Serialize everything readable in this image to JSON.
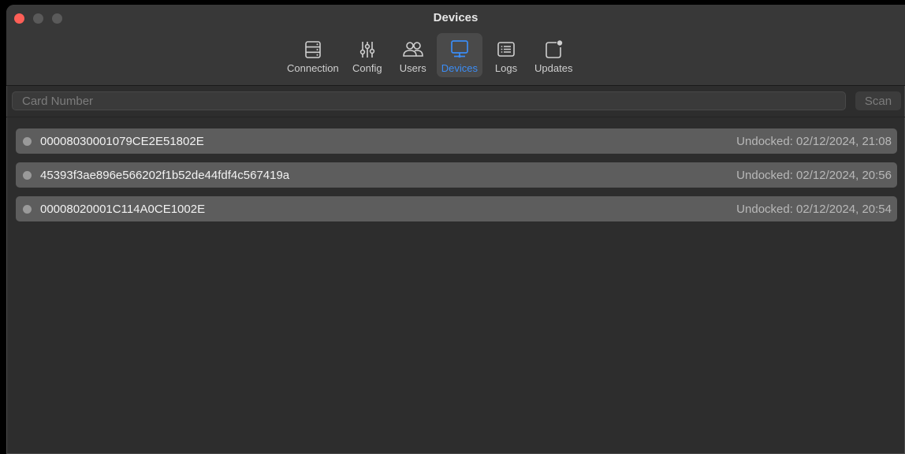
{
  "window": {
    "title": "Devices"
  },
  "toolbar": {
    "items": [
      {
        "label": "Connection",
        "icon": "server-icon",
        "active": false
      },
      {
        "label": "Config",
        "icon": "sliders-icon",
        "active": false
      },
      {
        "label": "Users",
        "icon": "users-icon",
        "active": false
      },
      {
        "label": "Devices",
        "icon": "monitor-icon",
        "active": true
      },
      {
        "label": "Logs",
        "icon": "list-icon",
        "active": false
      },
      {
        "label": "Updates",
        "icon": "badge-icon",
        "active": false
      }
    ]
  },
  "search": {
    "placeholder": "Card Number",
    "value": "",
    "scan_label": "Scan"
  },
  "devices": [
    {
      "name": "00008030001079CE2E51802E",
      "status": "Undocked: 02/12/2024, 21:08"
    },
    {
      "name": "45393f3ae896e566202f1b52de44fdf4c567419a",
      "status": "Undocked: 02/12/2024, 20:56"
    },
    {
      "name": "00008020001C114A0CE1002E",
      "status": "Undocked: 02/12/2024, 20:54"
    }
  ],
  "colors": {
    "accent": "#3b8df6",
    "close": "#fe5f57",
    "row_bg": "#5d5d5d",
    "window_bg": "#2d2d2d"
  }
}
